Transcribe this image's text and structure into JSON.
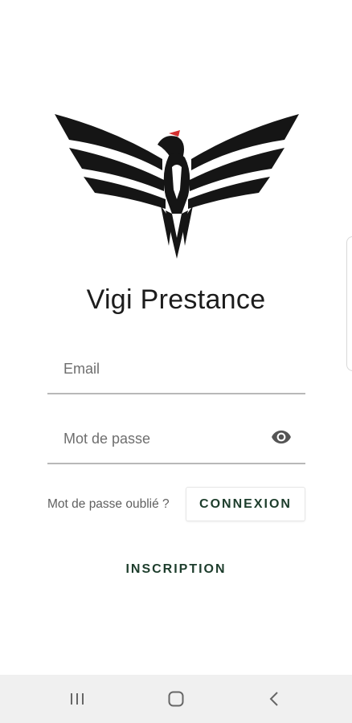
{
  "app": {
    "title": "Vigi Prestance",
    "logo_icon": "phoenix-logo-icon",
    "logo_accent_color": "#d32f2f",
    "brand_text_color": "#1d3d2c"
  },
  "login": {
    "email_placeholder": "Email",
    "email_value": "",
    "password_placeholder": "Mot de passe",
    "password_value": "",
    "password_toggle_icon": "eye-icon",
    "forgot_label": "Mot de passe oublié ?",
    "connexion_label": "CONNEXION",
    "inscription_label": "INSCRIPTION"
  },
  "navbar": {
    "recents_icon": "recents-icon",
    "home_icon": "home-icon",
    "back_icon": "back-icon"
  }
}
